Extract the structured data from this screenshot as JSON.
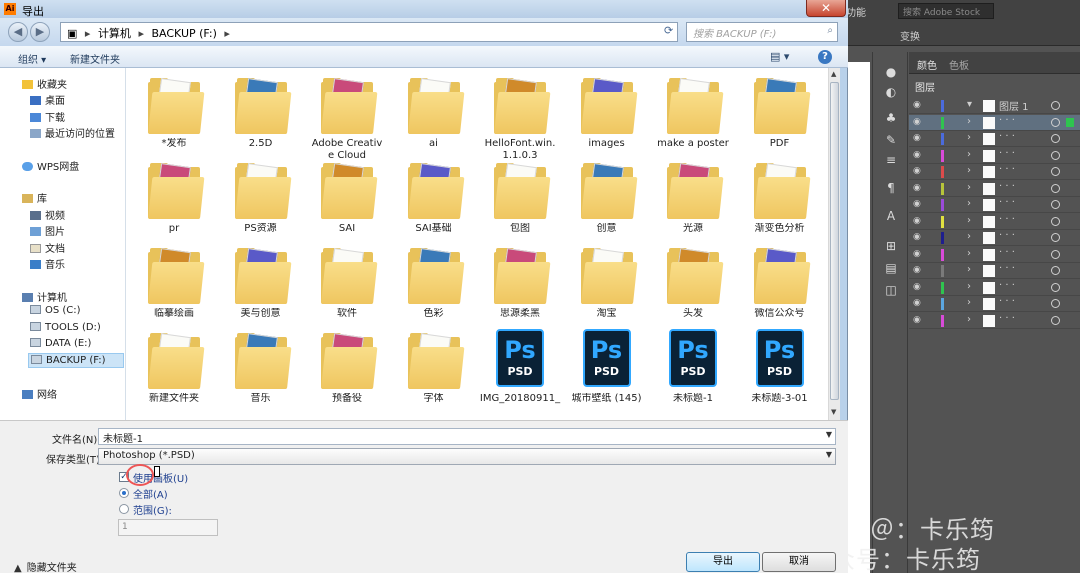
{
  "dialog": {
    "title": "导出",
    "app_icon": "Ai",
    "close_label": "✕",
    "path": [
      "计算机",
      "BACKUP (F:)"
    ],
    "search_placeholder": "搜索 BACKUP (F:)",
    "toolbar": {
      "organize": "组织 ▾",
      "new_folder": "新建文件夹"
    },
    "nav": {
      "favorites": "收藏夹",
      "desktop": "桌面",
      "downloads": "下载",
      "recent": "最近访问的位置",
      "wps": "WPS网盘",
      "libraries": "库",
      "videos": "视频",
      "pictures": "图片",
      "documents": "文档",
      "music": "音乐",
      "computer": "计算机",
      "drive_c": "OS (C:)",
      "drive_d": "TOOLS (D:)",
      "drive_e": "DATA (E:)",
      "drive_f": "BACKUP (F:)",
      "network": "网络"
    },
    "files": [
      {
        "name": "*发布",
        "type": "folder"
      },
      {
        "name": "2.5D",
        "type": "folder"
      },
      {
        "name": "Adobe Creative Cloud",
        "type": "folder"
      },
      {
        "name": "ai",
        "type": "folder"
      },
      {
        "name": "HelloFont.win.1.1.0.3",
        "type": "folder"
      },
      {
        "name": "images",
        "type": "folder"
      },
      {
        "name": "make a poster",
        "type": "folder"
      },
      {
        "name": "PDF",
        "type": "folder"
      },
      {
        "name": "pr",
        "type": "folder"
      },
      {
        "name": "PS资源",
        "type": "folder"
      },
      {
        "name": "SAI",
        "type": "folder"
      },
      {
        "name": "SAI基础",
        "type": "folder"
      },
      {
        "name": "包图",
        "type": "folder"
      },
      {
        "name": "创意",
        "type": "folder"
      },
      {
        "name": "光源",
        "type": "folder"
      },
      {
        "name": "渐变色分析",
        "type": "folder"
      },
      {
        "name": "临摹绘画",
        "type": "folder"
      },
      {
        "name": "美与创意",
        "type": "folder"
      },
      {
        "name": "软件",
        "type": "folder"
      },
      {
        "name": "色彩",
        "type": "folder"
      },
      {
        "name": "思源柔黑",
        "type": "folder"
      },
      {
        "name": "淘宝",
        "type": "folder"
      },
      {
        "name": "头发",
        "type": "folder"
      },
      {
        "name": "微信公众号",
        "type": "folder"
      },
      {
        "name": "新建文件夹",
        "type": "folder"
      },
      {
        "name": "音乐",
        "type": "folder"
      },
      {
        "name": "预备役",
        "type": "folder"
      },
      {
        "name": "字体",
        "type": "folder"
      },
      {
        "name": "IMG_20180911_",
        "type": "psd"
      },
      {
        "name": "城市壁纸 (145)",
        "type": "psd"
      },
      {
        "name": "未标题-1",
        "type": "psd"
      },
      {
        "name": "未标题-3-01",
        "type": "psd"
      }
    ],
    "psd_icon": {
      "ps": "Ps",
      "ext": "PSD"
    },
    "form": {
      "filename_label": "文件名(N):",
      "filename_value": "未标题-1",
      "filetype_label": "保存类型(T):",
      "filetype_value": "Photoshop (*.PSD)",
      "use_artboards": "使用画板(U)",
      "all": "全部(A)",
      "range": "范围(G):",
      "range_value": "1",
      "hide_folders": "隐藏文件夹",
      "export_button": "导出",
      "cancel_button": "取消"
    }
  },
  "app": {
    "toolbar": {
      "label1": "功能",
      "search": "搜索 Adobe Stock",
      "transform": "变换"
    },
    "panel_tabs": {
      "color": "颜色",
      "swatches": "色板"
    },
    "layers_title": "图层",
    "layer_name": "图层 1",
    "layer_colors": [
      "#4b6bdc",
      "#2fc44f",
      "#4b6bdc",
      "#d94bd9",
      "#dc4b4b",
      "#b7c43a",
      "#9b4bd9",
      "#e0e040",
      "#1e1e8e",
      "#d94bd9",
      "#7a7a7a",
      "#2fc44f",
      "#5ba6e0",
      "#d94bd9"
    ],
    "watermark1": "＠：卡乐筠",
    "watermark2": "公众号：卡乐筠"
  }
}
